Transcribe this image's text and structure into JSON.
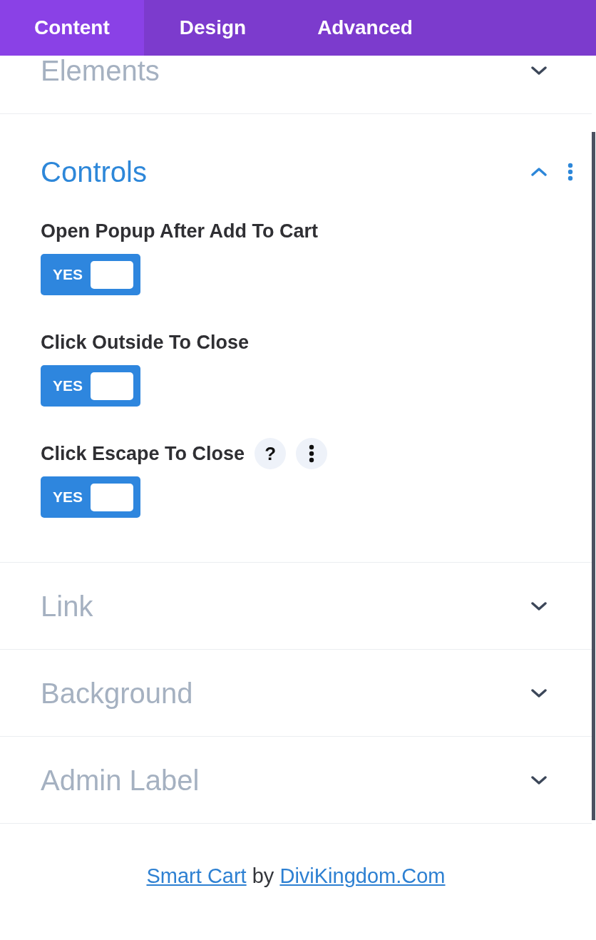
{
  "tabs": [
    {
      "label": "Content",
      "selected": true
    },
    {
      "label": "Design",
      "selected": false
    },
    {
      "label": "Advanced",
      "selected": false
    }
  ],
  "sections": [
    {
      "title": "Elements",
      "expanded": false,
      "show_options": false
    },
    {
      "title": "Controls",
      "expanded": true,
      "show_options": true,
      "fields": [
        {
          "label": "Open Popup After Add To Cart",
          "show_options": false,
          "toggle": {
            "on": true,
            "label": "YES"
          }
        },
        {
          "label": "Click Outside To Close",
          "show_options": false,
          "toggle": {
            "on": true,
            "label": "YES"
          }
        },
        {
          "label": "Click Escape To Close",
          "help_button": "?",
          "show_options": true,
          "toggle": {
            "on": true,
            "label": "YES"
          }
        }
      ]
    },
    {
      "title": "Link",
      "expanded": false,
      "show_options": false
    },
    {
      "title": "Background",
      "expanded": false,
      "show_options": false
    },
    {
      "title": "Admin Label",
      "expanded": false,
      "show_options": false
    }
  ],
  "footer": {
    "parts": [
      {
        "kind": "link",
        "text": "Smart Cart"
      },
      {
        "kind": "text",
        "text": "by"
      },
      {
        "kind": "link",
        "text": "DiviKingdom.Com"
      }
    ]
  }
}
